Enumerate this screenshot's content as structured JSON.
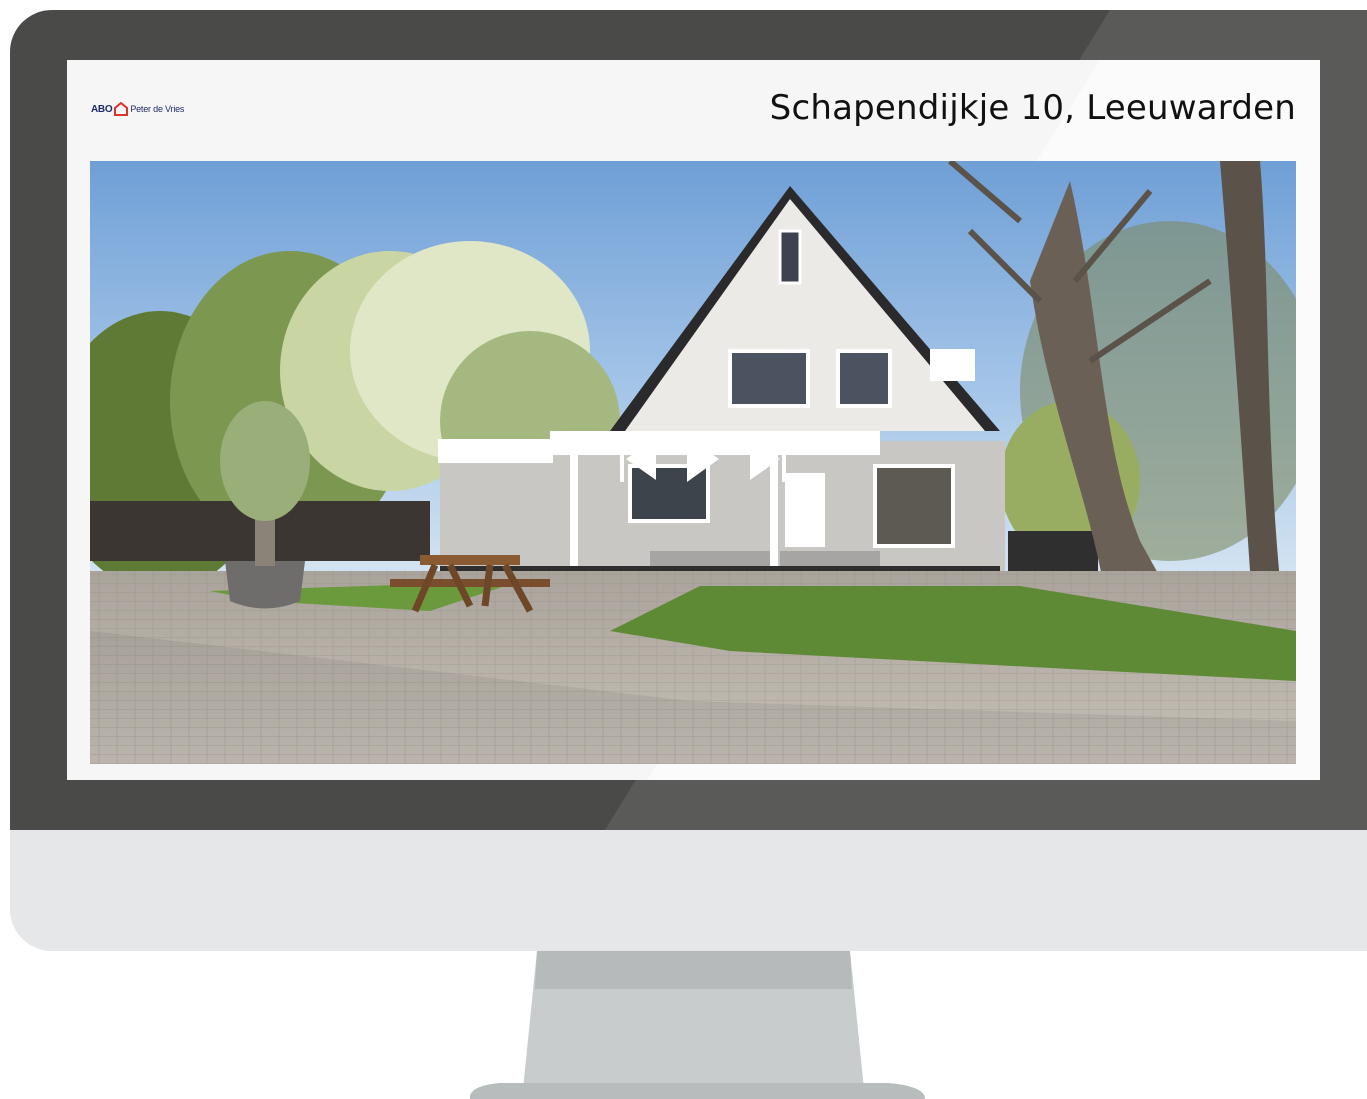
{
  "listing": {
    "title": "Schapendijkje 10, Leeuwarden"
  },
  "logo": {
    "brand": "ABO",
    "name": "Peter de Vries",
    "icon": "house-icon"
  },
  "slideshow": {
    "controls": [
      "previous-icon",
      "play-icon",
      "next-icon"
    ]
  },
  "colors": {
    "bezel": "#4a4a49",
    "chin": "#e6e7e9",
    "stand": "#c8cbcb",
    "logo_red": "#e0312b",
    "logo_navy": "#1e2a6e"
  }
}
